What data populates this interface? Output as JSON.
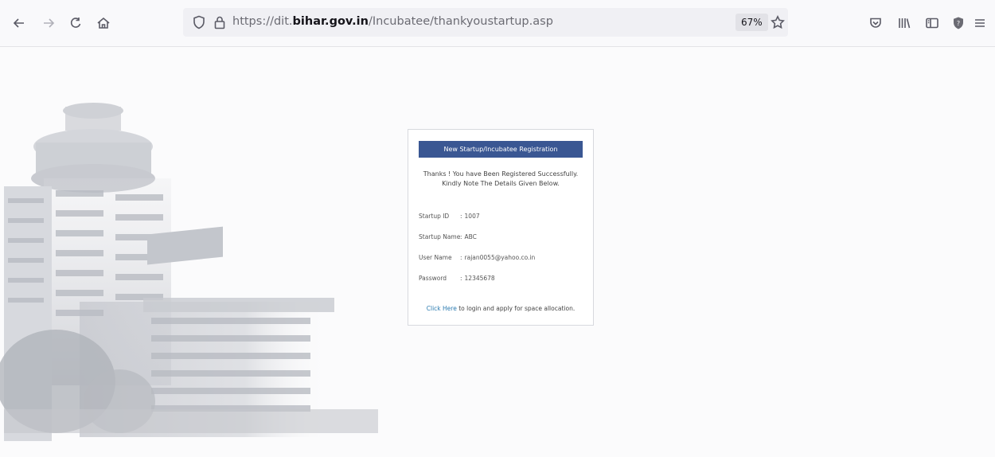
{
  "browser": {
    "url_prefix": "https://dit.",
    "url_domain": "bihar.gov.in",
    "url_path": "/Incubatee/thankyoustartup.asp",
    "zoom": "67%"
  },
  "card": {
    "title": "New Startup/Incubatee Registration",
    "message_line1": "Thanks ! You have Been Registered Successfully.",
    "message_line2": "Kindly Note The Details Given Below.",
    "details": [
      {
        "label": "Startup ID",
        "value": "1007"
      },
      {
        "label": "Startup Name",
        "value": "ABC"
      },
      {
        "label": "User Name",
        "value": "rajan0055@yahoo.co.in"
      },
      {
        "label": "Password",
        "value": "12345678"
      }
    ],
    "link_text": "Click Here",
    "link_suffix": " to login and apply for space allocation."
  },
  "colors": {
    "header_blue": "#3a5793",
    "link": "#2a7ab0",
    "toolbar_bg": "#f9f9fb"
  }
}
